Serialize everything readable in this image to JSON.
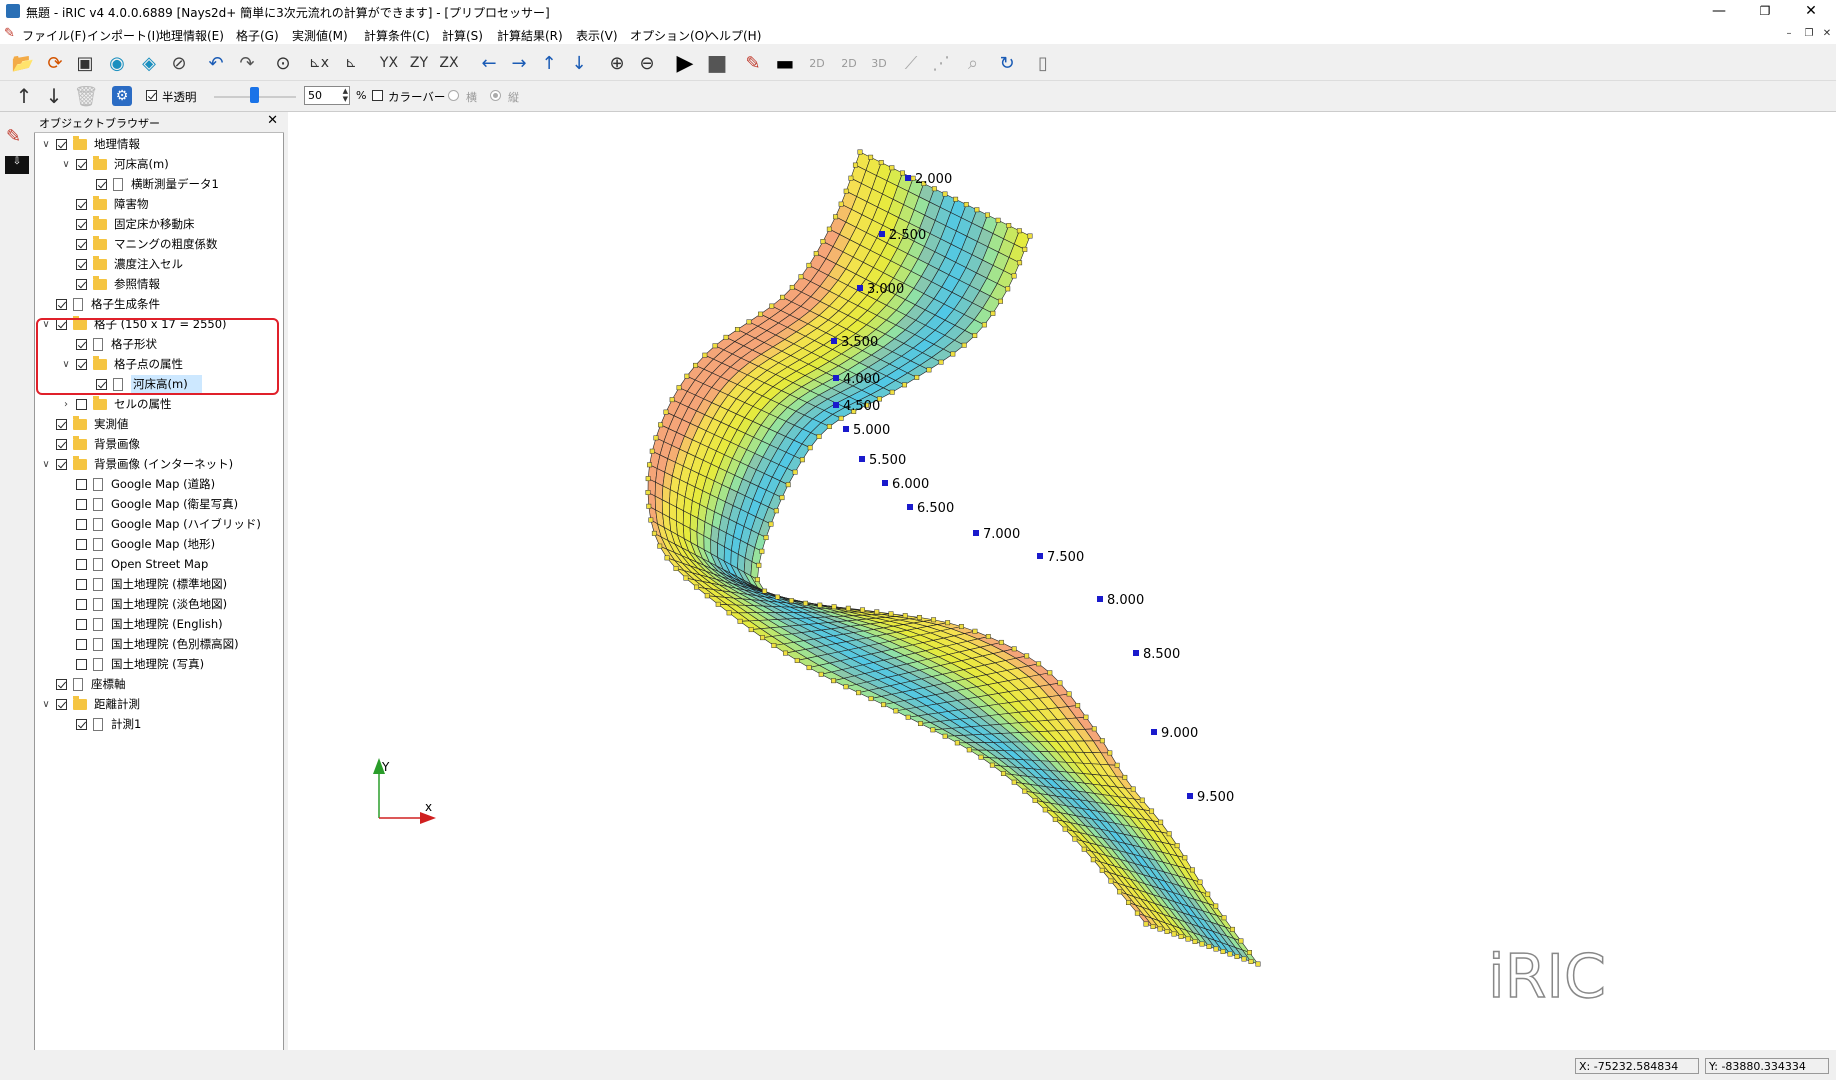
{
  "window": {
    "title": "無題 - iRIC v4 4.0.0.6889 [Nays2d+ 簡単に3次元流れの計算ができます] - [プリプロセッサー]",
    "minimize": "—",
    "restore": "❐",
    "close": "✕"
  },
  "menu": [
    "ファイル(F)",
    "インポート(I)",
    "地理情報(E)",
    "格子(G)",
    "実測値(M)",
    "計算条件(C)",
    "計算(S)",
    "計算結果(R)",
    "表示(V)",
    "オプション(O)",
    "ヘルプ(H)"
  ],
  "toolbar2": {
    "translucent_label": "半透明",
    "opacity_value": "50",
    "percent": "%",
    "colorbar_label": "カラーバー",
    "horizontal_label": "横",
    "vertical_label": "縦"
  },
  "object_browser": {
    "title": "オブジェクトブラウザー",
    "items": [
      {
        "label": "地理情報",
        "level": 0,
        "expander": "∨",
        "checked": true,
        "icon": "folder"
      },
      {
        "label": "河床高(m)",
        "level": 1,
        "expander": "∨",
        "checked": true,
        "icon": "folder"
      },
      {
        "label": "横断測量データ1",
        "level": 2,
        "expander": "",
        "checked": true,
        "icon": "doc"
      },
      {
        "label": "障害物",
        "level": 1,
        "expander": "",
        "checked": true,
        "icon": "folder"
      },
      {
        "label": "固定床か移動床",
        "level": 1,
        "expander": "",
        "checked": true,
        "icon": "folder"
      },
      {
        "label": "マニングの粗度係数",
        "level": 1,
        "expander": "",
        "checked": true,
        "icon": "folder"
      },
      {
        "label": "濃度注入セル",
        "level": 1,
        "expander": "",
        "checked": true,
        "icon": "folder"
      },
      {
        "label": "参照情報",
        "level": 1,
        "expander": "",
        "checked": true,
        "icon": "folder"
      },
      {
        "label": "格子生成条件",
        "level": 0,
        "expander": "",
        "checked": true,
        "icon": "doc"
      },
      {
        "label": "格子 (150 x 17 = 2550)",
        "level": 0,
        "expander": "∨",
        "checked": true,
        "icon": "folder"
      },
      {
        "label": "格子形状",
        "level": 1,
        "expander": "",
        "checked": true,
        "icon": "doc"
      },
      {
        "label": "格子点の属性",
        "level": 1,
        "expander": "∨",
        "checked": true,
        "icon": "folder"
      },
      {
        "label": "河床高(m)",
        "level": 2,
        "expander": "",
        "checked": true,
        "icon": "doc",
        "selected": true
      },
      {
        "label": "セルの属性",
        "level": 1,
        "expander": "›",
        "checked": false,
        "icon": "folder"
      },
      {
        "label": "実測値",
        "level": 0,
        "expander": "",
        "checked": true,
        "icon": "folder"
      },
      {
        "label": "背景画像",
        "level": 0,
        "expander": "",
        "checked": true,
        "icon": "folder"
      },
      {
        "label": "背景画像 (インターネット)",
        "level": 0,
        "expander": "∨",
        "checked": true,
        "icon": "folder"
      },
      {
        "label": "Google Map (道路)",
        "level": 1,
        "expander": "",
        "checked": false,
        "icon": "doc"
      },
      {
        "label": "Google Map (衛星写真)",
        "level": 1,
        "expander": "",
        "checked": false,
        "icon": "doc"
      },
      {
        "label": "Google Map (ハイブリッド)",
        "level": 1,
        "expander": "",
        "checked": false,
        "icon": "doc"
      },
      {
        "label": "Google Map (地形)",
        "level": 1,
        "expander": "",
        "checked": false,
        "icon": "doc"
      },
      {
        "label": "Open Street Map",
        "level": 1,
        "expander": "",
        "checked": false,
        "icon": "doc"
      },
      {
        "label": "国土地理院 (標準地図)",
        "level": 1,
        "expander": "",
        "checked": false,
        "icon": "doc"
      },
      {
        "label": "国土地理院 (淡色地図)",
        "level": 1,
        "expander": "",
        "checked": false,
        "icon": "doc"
      },
      {
        "label": "国土地理院 (English)",
        "level": 1,
        "expander": "",
        "checked": false,
        "icon": "doc"
      },
      {
        "label": "国土地理院 (色別標高図)",
        "level": 1,
        "expander": "",
        "checked": false,
        "icon": "doc"
      },
      {
        "label": "国土地理院 (写真)",
        "level": 1,
        "expander": "",
        "checked": false,
        "icon": "doc"
      },
      {
        "label": "座標軸",
        "level": 0,
        "expander": "",
        "checked": true,
        "icon": "doc"
      },
      {
        "label": "距離計測",
        "level": 0,
        "expander": "∨",
        "checked": true,
        "icon": "folder"
      },
      {
        "label": "計測1",
        "level": 1,
        "expander": "",
        "checked": true,
        "icon": "doc"
      }
    ]
  },
  "canvas": {
    "distance_labels": [
      "2.000",
      "2.500",
      "3.000",
      "3.500",
      "4.000",
      "4.500",
      "5.000",
      "5.500",
      "6.000",
      "6.500",
      "7.000",
      "7.500",
      "8.000",
      "8.500",
      "9.000",
      "9.500"
    ],
    "axis_y": "Y",
    "axis_x": "x",
    "logo_text": "iRIC"
  },
  "status": {
    "x": "X: -75232.584834",
    "y": "Y: -83880.334334"
  }
}
